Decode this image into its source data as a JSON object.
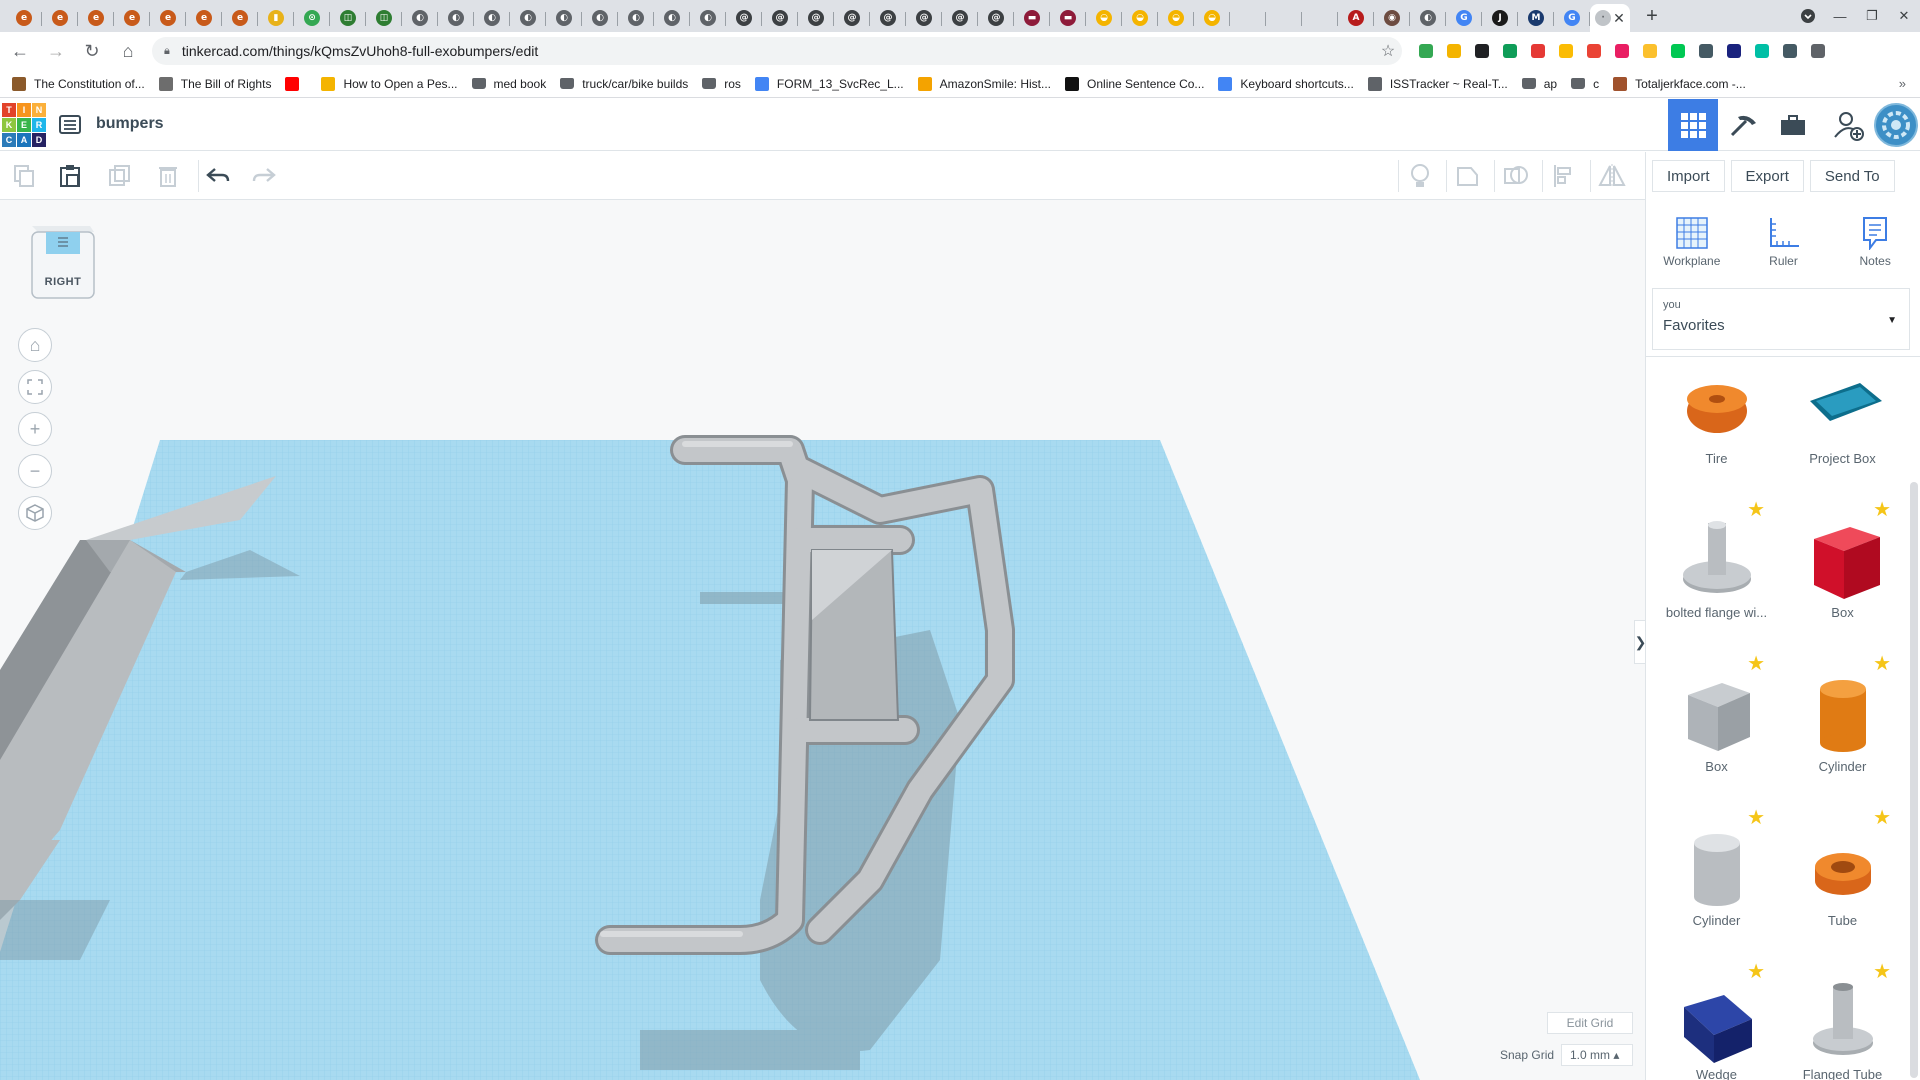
{
  "browser": {
    "tab_favicons": [
      {
        "color": "#c85a1a",
        "glyph": "e"
      },
      {
        "color": "#c85a1a",
        "glyph": "e"
      },
      {
        "color": "#c85a1a",
        "glyph": "e"
      },
      {
        "color": "#c85a1a",
        "glyph": "e"
      },
      {
        "color": "#c85a1a",
        "glyph": "e"
      },
      {
        "color": "#c85a1a",
        "glyph": "e"
      },
      {
        "color": "#c85a1a",
        "glyph": "e"
      },
      {
        "color": "#e8b21a",
        "glyph": "▮"
      },
      {
        "color": "#34a853",
        "glyph": "⊙"
      },
      {
        "color": "#2e7d32",
        "glyph": "◫"
      },
      {
        "color": "#2e7d32",
        "glyph": "◫"
      },
      {
        "color": "#5f6368",
        "glyph": "◐"
      },
      {
        "color": "#5f6368",
        "glyph": "◐"
      },
      {
        "color": "#5f6368",
        "glyph": "◐"
      },
      {
        "color": "#5f6368",
        "glyph": "◐"
      },
      {
        "color": "#5f6368",
        "glyph": "◐"
      },
      {
        "color": "#5f6368",
        "glyph": "◐"
      },
      {
        "color": "#5f6368",
        "glyph": "◐"
      },
      {
        "color": "#5f6368",
        "glyph": "◐"
      },
      {
        "color": "#5f6368",
        "glyph": "◐"
      },
      {
        "color": "#3c4043",
        "glyph": "@"
      },
      {
        "color": "#3c4043",
        "glyph": "@"
      },
      {
        "color": "#3c4043",
        "glyph": "@"
      },
      {
        "color": "#3c4043",
        "glyph": "@"
      },
      {
        "color": "#3c4043",
        "glyph": "@"
      },
      {
        "color": "#3c4043",
        "glyph": "@"
      },
      {
        "color": "#3c4043",
        "glyph": "@"
      },
      {
        "color": "#3c4043",
        "glyph": "@"
      },
      {
        "color": "#8e1b3a",
        "glyph": "▬"
      },
      {
        "color": "#8e1b3a",
        "glyph": "▬"
      },
      {
        "color": "#f4b400",
        "glyph": "◒"
      },
      {
        "color": "#f4b400",
        "glyph": "◒"
      },
      {
        "color": "#f4b400",
        "glyph": "◒"
      },
      {
        "color": "#f4b400",
        "glyph": "◒"
      },
      {
        "color": "#dee1e6",
        "glyph": ""
      },
      {
        "color": "#dee1e6",
        "glyph": ""
      },
      {
        "color": "#dee1e6",
        "glyph": ""
      },
      {
        "color": "#b71c1c",
        "glyph": "A"
      },
      {
        "color": "#6d4c41",
        "glyph": "◉"
      },
      {
        "color": "#5f6368",
        "glyph": "◐"
      },
      {
        "color": "#4285f4",
        "glyph": "G"
      },
      {
        "color": "#1a1a1a",
        "glyph": "J"
      },
      {
        "color": "#1a3a6e",
        "glyph": "M"
      },
      {
        "color": "#4285f4",
        "glyph": "G"
      }
    ],
    "active_tab_favicon": {
      "color": "#c0c4c8",
      "glyph": "·"
    },
    "url": "tinkercad.com/things/kQmsZvUhoh8-full-exobumpers/edit",
    "extension_colors": [
      "#34a853",
      "#f4b400",
      "#202124",
      "#0f9d58",
      "#e53935",
      "#fbbc04",
      "#ea4335",
      "#e91e63",
      "#fbc02d",
      "#00c853",
      "#455a64",
      "#1a237e",
      "#00bfa5",
      "#455a64",
      "#5f6368"
    ],
    "bookmarks": [
      {
        "label": "The Constitution of...",
        "icon_color": "#8b5a2b",
        "folder": false
      },
      {
        "label": "The Bill of Rights",
        "icon_color": "#6d6d6d",
        "folder": false
      },
      {
        "label": "",
        "icon_color": "#ff0000",
        "folder": false
      },
      {
        "label": "How to Open a Pes...",
        "icon_color": "#f4b400",
        "folder": false
      },
      {
        "label": "med book",
        "icon_color": "#5f6368",
        "folder": true
      },
      {
        "label": "truck/car/bike builds",
        "icon_color": "#5f6368",
        "folder": true
      },
      {
        "label": "ros",
        "icon_color": "#5f6368",
        "folder": true
      },
      {
        "label": "FORM_13_SvcRec_L...",
        "icon_color": "#4285f4",
        "folder": false
      },
      {
        "label": "AmazonSmile: Hist...",
        "icon_color": "#f4a300",
        "folder": false
      },
      {
        "label": "Online Sentence Co...",
        "icon_color": "#111111",
        "folder": false
      },
      {
        "label": "Keyboard shortcuts...",
        "icon_color": "#4285f4",
        "folder": false
      },
      {
        "label": "ISSTracker ~ Real-T...",
        "icon_color": "#5f6368",
        "folder": false
      },
      {
        "label": "ap",
        "icon_color": "#5f6368",
        "folder": true
      },
      {
        "label": "c",
        "icon_color": "#5f6368",
        "folder": true
      },
      {
        "label": "Totaljerkface.com -...",
        "icon_color": "#a0522d",
        "folder": false
      }
    ],
    "bookmarks_more": "»"
  },
  "app": {
    "logo_letters": [
      "T",
      "I",
      "N",
      "K",
      "E",
      "R",
      "C",
      "A",
      "D"
    ],
    "logo_colors": [
      "#e2432a",
      "#f7941d",
      "#fbb03b",
      "#8dc63f",
      "#39b54a",
      "#1fb6ea",
      "#2b7bb9",
      "#1b75bc",
      "#262262"
    ],
    "design_title": "bumpers",
    "accent": "#3d7de4"
  },
  "toolbar": {
    "import_label": "Import",
    "export_label": "Export",
    "send_to_label": "Send To"
  },
  "viewport": {
    "viewcube_label": "RIGHT",
    "edit_grid_label": "Edit Grid",
    "snap_grid_label": "Snap Grid",
    "snap_grid_value": "1.0 mm ▴",
    "panel_toggle": "❯",
    "workplane_color": "#a8daf0",
    "grid_line_color": "#7cc3e2"
  },
  "panel": {
    "tools": [
      {
        "label": "Workplane"
      },
      {
        "label": "Ruler"
      },
      {
        "label": "Notes"
      }
    ],
    "library_category": "you",
    "library_value": "Favorites",
    "shapes": [
      {
        "label": "Tire",
        "starred": false
      },
      {
        "label": "Project Box",
        "starred": false
      },
      {
        "label": "bolted flange wi...",
        "starred": true
      },
      {
        "label": "Box",
        "starred": true
      },
      {
        "label": "Box",
        "starred": true
      },
      {
        "label": "Cylinder",
        "starred": true
      },
      {
        "label": "Cylinder",
        "starred": true
      },
      {
        "label": "Tube",
        "starred": true
      },
      {
        "label": "Wedge",
        "starred": true
      },
      {
        "label": "Flanged Tube",
        "starred": true
      }
    ]
  }
}
